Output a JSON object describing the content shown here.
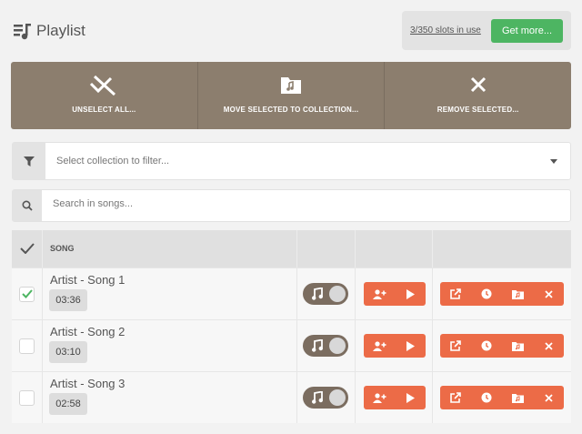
{
  "header": {
    "title": "Playlist",
    "icon": "playlist-icon",
    "slots_text": "3/350 slots in use",
    "get_more_label": "Get more..."
  },
  "actions": [
    {
      "icon": "unselect-icon",
      "label": "UNSELECT ALL..."
    },
    {
      "icon": "folder-music-icon",
      "label": "MOVE SELECTED TO COLLECTION..."
    },
    {
      "icon": "close-icon",
      "label": "REMOVE SELECTED..."
    }
  ],
  "filter": {
    "icon": "filter-icon",
    "placeholder": "Select collection to filter..."
  },
  "search": {
    "icon": "search-icon",
    "placeholder": "Search in songs..."
  },
  "table": {
    "header": {
      "song": "SONG"
    },
    "rows": [
      {
        "checked": true,
        "title": "Artist - Song 1",
        "duration": "03:36"
      },
      {
        "checked": false,
        "title": "Artist - Song 2",
        "duration": "03:10"
      },
      {
        "checked": false,
        "title": "Artist - Song 3",
        "duration": "02:58"
      }
    ]
  },
  "colors": {
    "background": "#f2f2f2",
    "action_bar": "#8c7e6e",
    "accent_orange": "#ec6b47",
    "get_more_green": "#4db562",
    "toggle": "#7b6d60",
    "check_green": "#4db562"
  }
}
